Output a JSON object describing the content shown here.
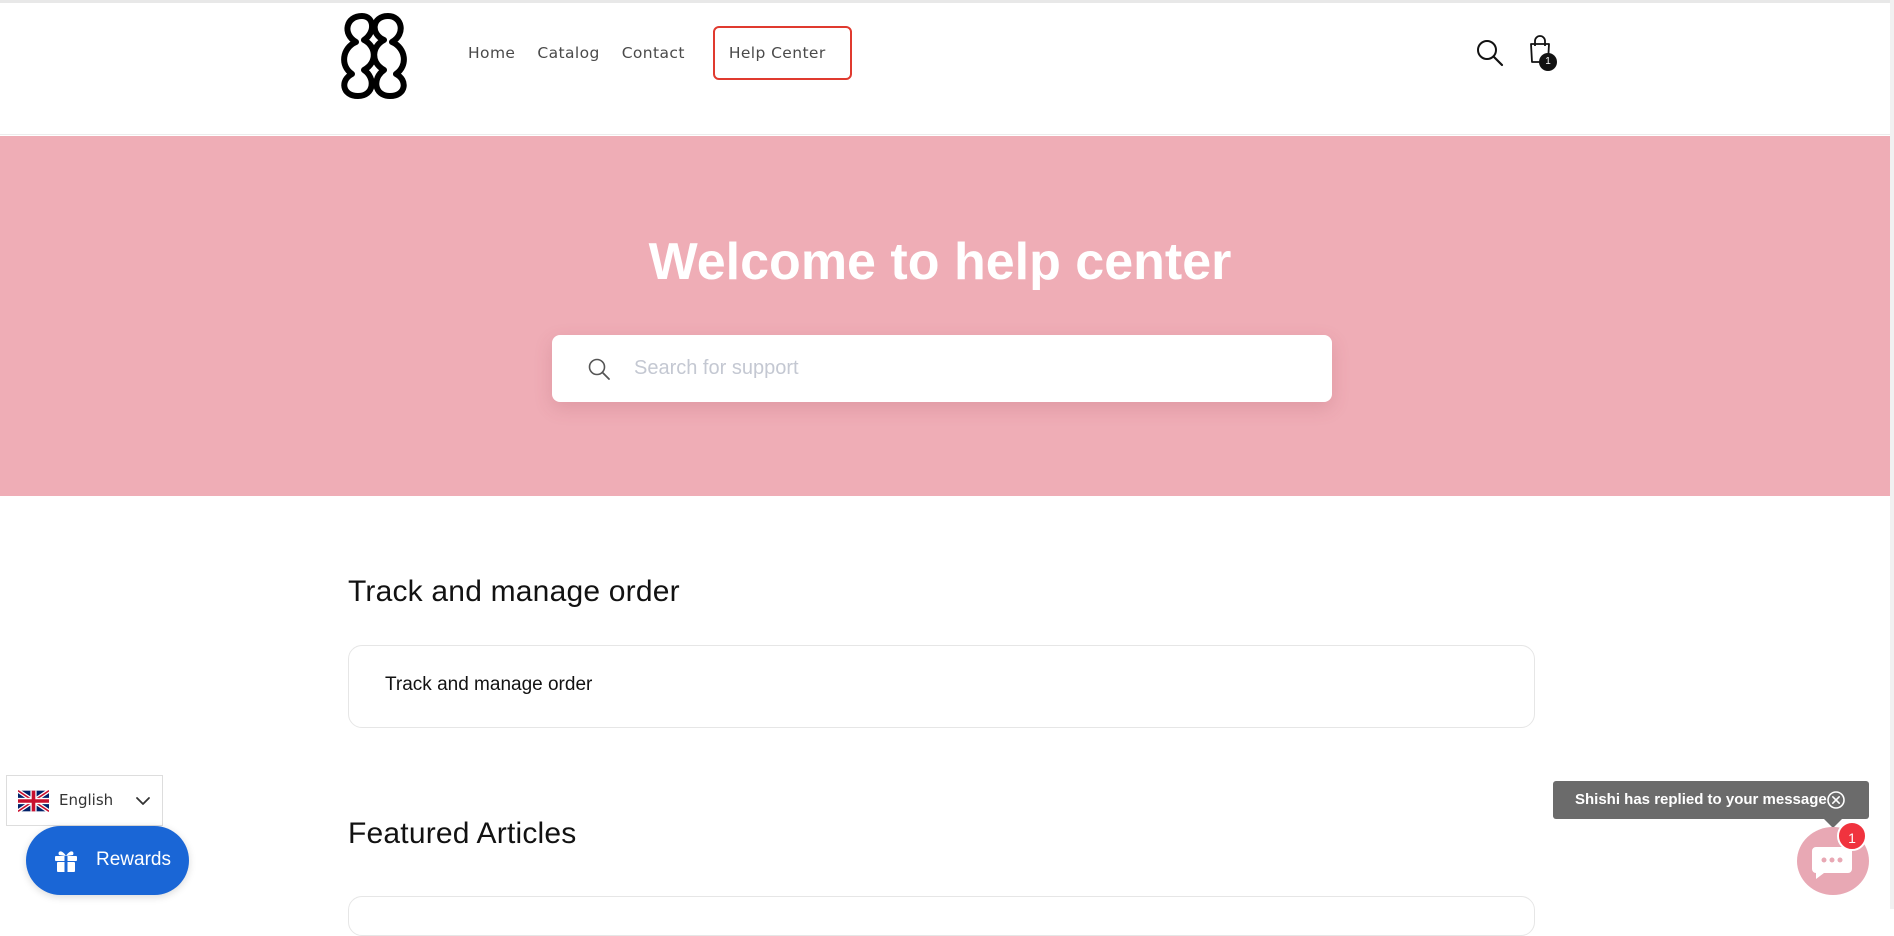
{
  "header": {
    "logo_icon": "ss-logo-icon",
    "nav": [
      {
        "label": "Home"
      },
      {
        "label": "Catalog"
      },
      {
        "label": "Contact"
      },
      {
        "label": "Help Center",
        "active": true
      }
    ],
    "search_icon": "search-icon",
    "cart_icon": "shopping-bag-icon",
    "cart_count": "1"
  },
  "hero": {
    "title": "Welcome to help center",
    "search_placeholder": "Search for support",
    "background_color": "#efadb6"
  },
  "sections": [
    {
      "title": "Track and manage order",
      "items": [
        {
          "label": "Track and manage order"
        }
      ]
    },
    {
      "title": "Featured Articles",
      "items": []
    }
  ],
  "language": {
    "label": "English",
    "flag_icon": "uk-flag-icon"
  },
  "rewards": {
    "label": "Rewards",
    "color": "#1a66d6"
  },
  "chat": {
    "toast_text": "Shishi has replied to your message",
    "badge_count": "1"
  },
  "colors": {
    "highlight_border": "#e03a2f",
    "chat_badge": "#f0333e"
  }
}
